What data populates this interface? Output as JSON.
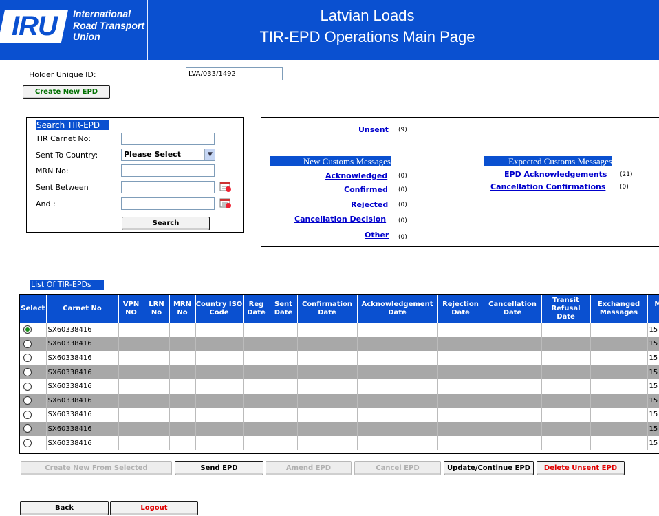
{
  "header": {
    "logo_abbrev": "IRU",
    "logo_lines": [
      "International",
      "Road Transport",
      "Union"
    ],
    "title_line1": "Latvian Loads",
    "title_line2": "TIR-EPD Operations Main Page"
  },
  "holder": {
    "label": "Holder Unique ID:",
    "value": "LVA/033/1492"
  },
  "create_button": "Create New EPD",
  "search": {
    "title": "Search TIR-EPD",
    "carnet_label": "TIR Carnet No:",
    "country_label": "Sent To Country:",
    "country_selected": "Please Select",
    "mrn_label": "MRN No:",
    "between_label": "Sent Between",
    "and_label": "And :",
    "button": "Search",
    "icons": {
      "calendar": "calendar-icon",
      "dropdown": "chevron-down-icon"
    }
  },
  "messages": {
    "unsent": {
      "label": "Unsent",
      "count": "(9)"
    },
    "new_title": "New Customs Messages",
    "new_items": [
      {
        "label": "Acknowledged",
        "count": "(0)"
      },
      {
        "label": "Confirmed",
        "count": "(0)"
      },
      {
        "label": "Rejected",
        "count": "(0)"
      },
      {
        "label": "Cancellation Decision",
        "count": "(0)"
      },
      {
        "label": "Other",
        "count": "(0)"
      }
    ],
    "expected_title": "Expected Customs Messages",
    "expected_items": [
      {
        "label": "EPD Acknowledgements",
        "count": "(21)"
      },
      {
        "label": "Cancellation Confirmations",
        "count": "(0)"
      }
    ]
  },
  "list": {
    "title": "List Of TIR-EPDs",
    "columns": [
      "Select",
      "Carnet No",
      "VPN NO",
      "LRN No",
      "MRN No",
      "Country ISO Code",
      "Reg Date",
      "Sent Date",
      "Confirmation Date",
      "Acknowledgement Date",
      "Rejection Date",
      "Cancellation Date",
      "Transit Refusal Date",
      "Exchanged Messages",
      "Message Type"
    ],
    "rows": [
      {
        "carnet": "SX60338416",
        "message_type": "15",
        "selected": true
      },
      {
        "carnet": "SX60338416",
        "message_type": "15",
        "selected": false
      },
      {
        "carnet": "SX60338416",
        "message_type": "15",
        "selected": false
      },
      {
        "carnet": "SX60338416",
        "message_type": "15",
        "selected": false
      },
      {
        "carnet": "SX60338416",
        "message_type": "15",
        "selected": false
      },
      {
        "carnet": "SX60338416",
        "message_type": "15",
        "selected": false
      },
      {
        "carnet": "SX60338416",
        "message_type": "15",
        "selected": false
      },
      {
        "carnet": "SX60338416",
        "message_type": "15",
        "selected": false
      },
      {
        "carnet": "SX60338416",
        "message_type": "15",
        "selected": false
      }
    ]
  },
  "actions": {
    "create_from_selected": "Create New From Selected",
    "send": "Send EPD",
    "amend": "Amend EPD",
    "cancel": "Cancel EPD",
    "update": "Update/Continue EPD",
    "delete": "Delete Unsent EPD",
    "back": "Back",
    "logout": "Logout"
  },
  "colors": {
    "brand_blue": "#0a50d0",
    "link": "#0000cc",
    "danger": "#e00000",
    "create_green": "#007000"
  }
}
